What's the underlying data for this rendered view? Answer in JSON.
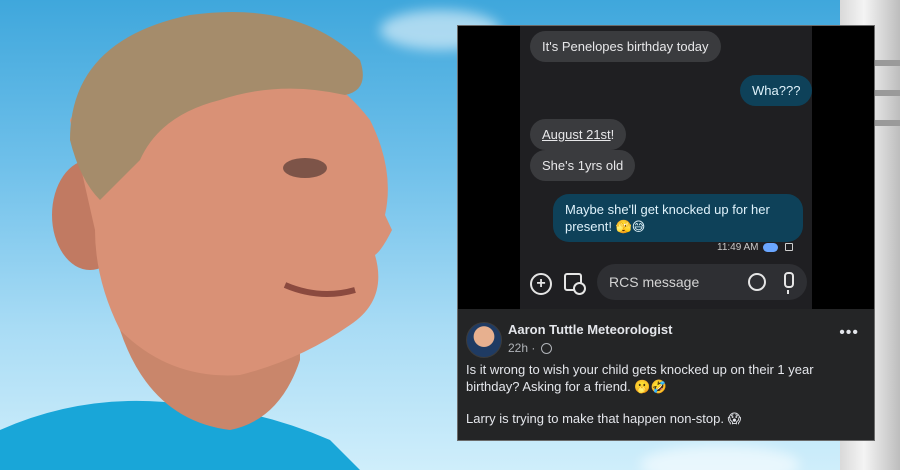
{
  "chat": {
    "messages": [
      {
        "text": "It's Penelopes birthday today",
        "dir": "in"
      },
      {
        "text": "Wha???",
        "dir": "out"
      },
      {
        "text": "August 21st",
        "suffix": "!",
        "dir": "in"
      },
      {
        "text": "She's 1yrs old",
        "dir": "in"
      },
      {
        "text": "Maybe she'll get knocked up for her present! 🫣😅",
        "dir": "out"
      }
    ],
    "timestamp": "11:49 AM",
    "compose_placeholder": "RCS message"
  },
  "post": {
    "author": "Aaron Tuttle Meteorologist",
    "time": "22h",
    "more": "•••",
    "text_1": "Is it wrong to wish your child gets knocked up on their 1 year birthday? Asking for a friend. 🫢🤣",
    "text_2": "Larry is trying to make that happen non-stop. 😱"
  },
  "colors": {
    "outgoing_bubble": "#0e4159",
    "incoming_bubble": "#3a3b3e",
    "post_background": "#242526",
    "sky": "#6fc0ea"
  }
}
